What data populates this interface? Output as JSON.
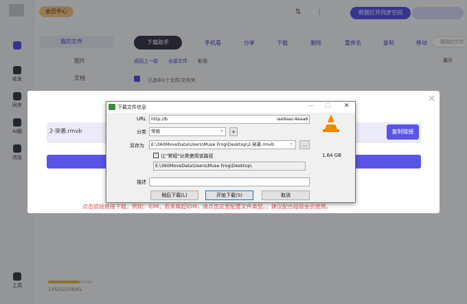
{
  "topbar": {
    "vip_label": "会员中心",
    "sync_label": "帮我打开同步空间"
  },
  "rail": {
    "items": [
      {
        "label": "收发"
      },
      {
        "label": "同步"
      },
      {
        "label": "AI圈"
      },
      {
        "label": "消息"
      },
      {
        "label": "工具"
      }
    ]
  },
  "sidebar": {
    "my_files": "我的文件",
    "items": [
      {
        "label": "图片"
      },
      {
        "label": "文档"
      }
    ]
  },
  "toolbar": {
    "download_helper": "下载助手",
    "actions": [
      "手机看",
      "分享",
      "下载",
      "删除",
      "重命名",
      "复制",
      "移动"
    ],
    "search_placeholder": "搜我的文件"
  },
  "breadcrumb": {
    "back": "返回上一级",
    "all": "全部文件",
    "current": "影视"
  },
  "list_header": {
    "selection": "已选中1个文件/文件夹",
    "expand": "展开"
  },
  "storage": {
    "text": "1452G/2068G",
    "used_fraction": 0.7
  },
  "modal": {
    "file_name": "2-突袭.rmvb",
    "copy_label": "复制链接",
    "tip": "点击链接直接下载，例如：IDM，若未唤起IDM，请点击这里配置文件类型。，建议配合超级会员使用。"
  },
  "idm": {
    "title": "下载文件信息",
    "url_label": "URL",
    "url_value": "http://b",
    "url_tail": "iae9aec4eaa6",
    "category_label": "分类",
    "category_value": "常规",
    "add_label": "+",
    "saveas_label": "另存为",
    "saveas_value": "E:\\360MoveData\\Users\\Muse Frog\\Desktop\\2-突袭.rmvb",
    "browse_label": "...",
    "remember_label": "让\"常规\"分类使用该路径",
    "remember_path": "E:\\360MoveData\\Users\\Muse Frog\\Desktop\\",
    "description_label": "描述",
    "size": "1.64 GB",
    "later_button": "稍后下载(L)",
    "start_button": "开始下载(S)",
    "cancel_button": "取消"
  }
}
